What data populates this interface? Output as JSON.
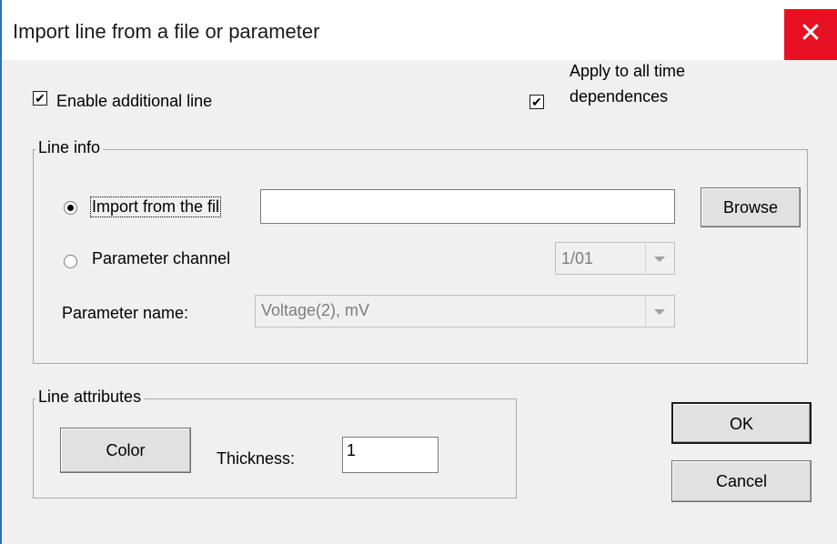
{
  "window": {
    "title": "Import line from a file or parameter",
    "close_glyph": "✕"
  },
  "enable_line": {
    "label": "Enable additional line",
    "checked": true
  },
  "apply_all": {
    "label_line1": "Apply to all time",
    "label_line2": "dependences",
    "checked": true
  },
  "line_info": {
    "title": "Line info",
    "import_radio_label": "Import from the fil",
    "import_selected": true,
    "file_path": "",
    "browse_label": "Browse",
    "param_radio_label": "Parameter channel",
    "param_selected": false,
    "channel_value": "1/01",
    "param_name_label": "Parameter name:",
    "param_name_value": "Voltage(2), mV"
  },
  "line_attributes": {
    "title": "Line attributes",
    "color_label": "Color",
    "thickness_label": "Thickness:",
    "thickness_value": "1"
  },
  "buttons": {
    "ok_label": "OK",
    "cancel_label": "Cancel"
  },
  "icons": {
    "check": "check-icon",
    "close": "close-icon",
    "dropdown": "chevron-down-icon"
  },
  "colors": {
    "close_bg": "#e81123",
    "window_border": "#2d6fb5",
    "face": "#f0f0f0"
  }
}
